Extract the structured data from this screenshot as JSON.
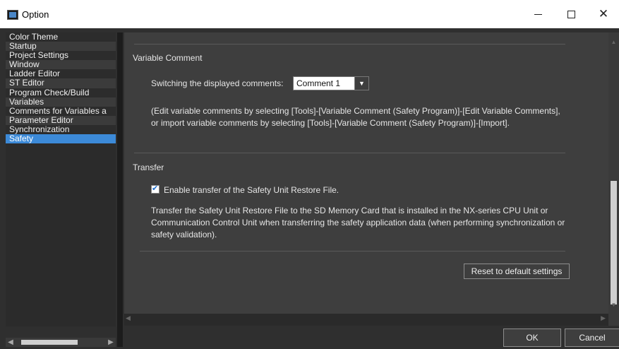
{
  "window": {
    "title": "Option",
    "minimize_icon": "minimize-icon",
    "maximize_icon": "maximize-icon",
    "close_icon": "close-icon",
    "close_glyph": "✕"
  },
  "sidebar": {
    "items": [
      {
        "label": "Color Theme"
      },
      {
        "label": "Startup"
      },
      {
        "label": "Project Settings"
      },
      {
        "label": "Window"
      },
      {
        "label": "Ladder Editor"
      },
      {
        "label": "ST Editor"
      },
      {
        "label": "Program Check/Build"
      },
      {
        "label": "Variables"
      },
      {
        "label": "Comments for Variables a"
      },
      {
        "label": "Parameter Editor"
      },
      {
        "label": "Synchronization"
      },
      {
        "label": "Safety"
      }
    ],
    "selected_index": 11,
    "selected_color": "#3c8ad8"
  },
  "variable_comment": {
    "heading": "Variable Comment",
    "switch_label": "Switching the displayed comments:",
    "select_value": "Comment 1",
    "note": "(Edit variable comments by selecting [Tools]-[Variable Comment (Safety Program)]-[Edit Variable Comments], or import variable comments by selecting [Tools]-[Variable Comment (Safety Program)]-[Import]."
  },
  "transfer": {
    "heading": "Transfer",
    "checkbox_label": "Enable transfer of the Safety Unit Restore File.",
    "checkbox_checked": true,
    "description": "Transfer the Safety Unit Restore File to the SD Memory Card that is installed in the NX-series CPU Unit or Communication Control Unit when transferring the safety application data (when performing synchronization or safety validation)."
  },
  "buttons": {
    "reset": "Reset to default settings",
    "ok": "OK",
    "cancel": "Cancel"
  },
  "colors": {
    "background": "#2f2f2f",
    "panel": "#3e3e3e",
    "accent": "#3c8ad8"
  }
}
